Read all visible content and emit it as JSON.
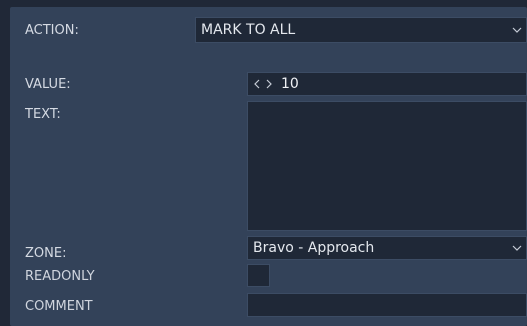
{
  "form": {
    "action": {
      "label": "ACTION:",
      "value": "MARK TO ALL"
    },
    "value": {
      "label": "VALUE:",
      "current": "10"
    },
    "text": {
      "label": "TEXT:",
      "current": ""
    },
    "zone": {
      "label": "ZONE:",
      "value": "Bravo - Approach"
    },
    "readonly": {
      "label": "READONLY",
      "checked": false
    },
    "comment": {
      "label": "COMMENT",
      "current": ""
    }
  },
  "icons": {
    "dropdown": "chevron-down-icon",
    "decrement": "chevron-left-icon",
    "increment": "chevron-right-icon"
  },
  "colors": {
    "background": "#202837",
    "panel": "#334259",
    "field": "#1f2837",
    "text": "#dfe3ea"
  }
}
